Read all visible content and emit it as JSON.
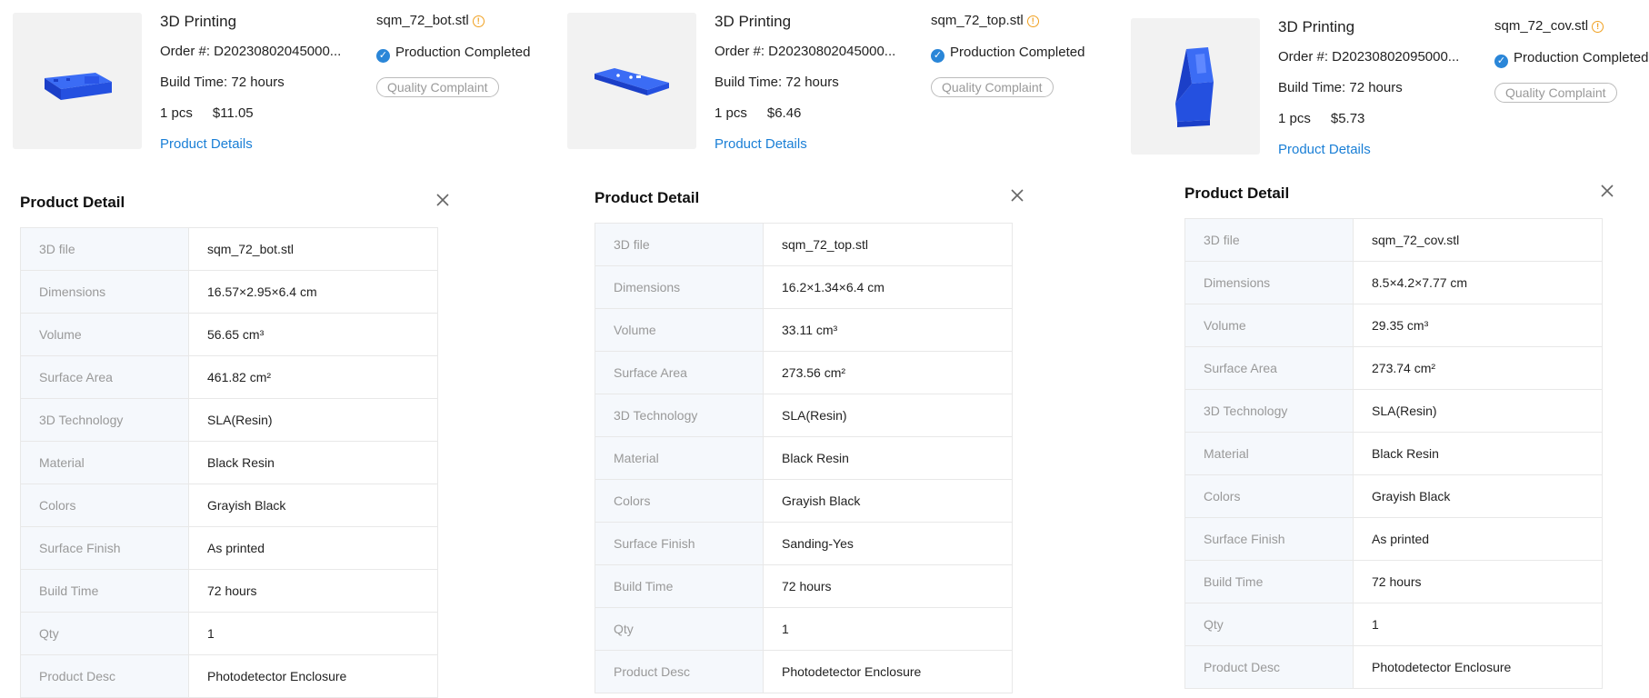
{
  "colors": {
    "accent_blue": "#1a7fd6",
    "check_blue": "#2a86d8",
    "warning_orange": "#f0a020",
    "model_blue": "#1f4fe0"
  },
  "cards": [
    {
      "title": "3D Printing",
      "order": "Order #: D20230802045000...",
      "build_time": "Build Time: 72 hours",
      "qty": "1 pcs",
      "price": "$11.05",
      "details_link": "Product Details",
      "file": "sqm_72_bot.stl",
      "status": "Production Completed",
      "complaint": "Quality Complaint",
      "model_icon": "box-model-icon"
    },
    {
      "title": "3D Printing",
      "order": "Order #: D20230802045000...",
      "build_time": "Build Time: 72 hours",
      "qty": "1 pcs",
      "price": "$6.46",
      "details_link": "Product Details",
      "file": "sqm_72_top.stl",
      "status": "Production Completed",
      "complaint": "Quality Complaint",
      "model_icon": "plate-model-icon"
    },
    {
      "title": "3D Printing",
      "order": "Order #: D20230802095000...",
      "build_time": "Build Time: 72 hours",
      "qty": "1 pcs",
      "price": "$5.73",
      "details_link": "Product Details",
      "file": "sqm_72_cov.stl",
      "status": "Production Completed",
      "complaint": "Quality Complaint",
      "model_icon": "cover-model-icon"
    }
  ],
  "details": [
    {
      "title": "Product Detail",
      "rows": [
        {
          "k": "3D file",
          "v": "sqm_72_bot.stl"
        },
        {
          "k": "Dimensions",
          "v": "16.57×2.95×6.4 cm"
        },
        {
          "k": "Volume",
          "v": "56.65 cm³"
        },
        {
          "k": "Surface Area",
          "v": "461.82 cm²"
        },
        {
          "k": "3D Technology",
          "v": "SLA(Resin)"
        },
        {
          "k": "Material",
          "v": "Black Resin"
        },
        {
          "k": "Colors",
          "v": "Grayish Black"
        },
        {
          "k": "Surface Finish",
          "v": "As printed"
        },
        {
          "k": "Build Time",
          "v": "72 hours"
        },
        {
          "k": "Qty",
          "v": "1"
        },
        {
          "k": "Product Desc",
          "v": "Photodetector Enclosure"
        }
      ]
    },
    {
      "title": "Product Detail",
      "rows": [
        {
          "k": "3D file",
          "v": "sqm_72_top.stl"
        },
        {
          "k": "Dimensions",
          "v": "16.2×1.34×6.4 cm"
        },
        {
          "k": "Volume",
          "v": "33.11 cm³"
        },
        {
          "k": "Surface Area",
          "v": "273.56 cm²"
        },
        {
          "k": "3D Technology",
          "v": "SLA(Resin)"
        },
        {
          "k": "Material",
          "v": "Black Resin"
        },
        {
          "k": "Colors",
          "v": "Grayish Black"
        },
        {
          "k": "Surface Finish",
          "v": "Sanding-Yes"
        },
        {
          "k": "Build Time",
          "v": "72 hours"
        },
        {
          "k": "Qty",
          "v": "1"
        },
        {
          "k": "Product Desc",
          "v": "Photodetector Enclosure"
        }
      ]
    },
    {
      "title": "Product Detail",
      "rows": [
        {
          "k": "3D file",
          "v": "sqm_72_cov.stl"
        },
        {
          "k": "Dimensions",
          "v": "8.5×4.2×7.77 cm"
        },
        {
          "k": "Volume",
          "v": "29.35 cm³"
        },
        {
          "k": "Surface Area",
          "v": "273.74 cm²"
        },
        {
          "k": "3D Technology",
          "v": "SLA(Resin)"
        },
        {
          "k": "Material",
          "v": "Black Resin"
        },
        {
          "k": "Colors",
          "v": "Grayish Black"
        },
        {
          "k": "Surface Finish",
          "v": "As printed"
        },
        {
          "k": "Build Time",
          "v": "72 hours"
        },
        {
          "k": "Qty",
          "v": "1"
        },
        {
          "k": "Product Desc",
          "v": "Photodetector Enclosure"
        }
      ]
    }
  ]
}
